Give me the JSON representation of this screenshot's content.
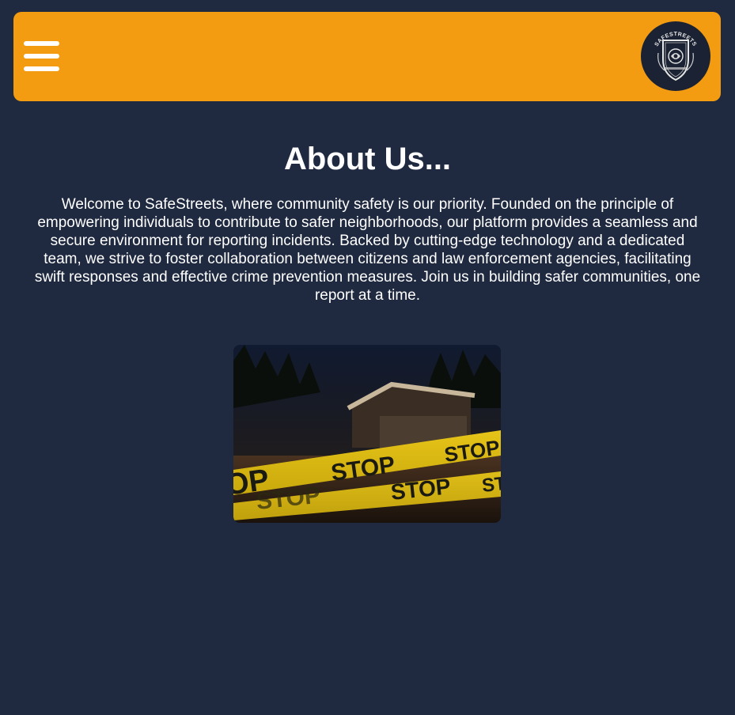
{
  "header": {
    "menu_icon": "hamburger-menu-icon",
    "logo_icon": "safestreets-badge-logo",
    "logo_text": "SAFESTREETS",
    "background_color": "#f39c12"
  },
  "about": {
    "title": "About Us...",
    "body": "Welcome to SafeStreets, where community safety is our priority. Founded on the principle of empowering individuals to contribute to safer neighborhoods, our platform provides a seamless and secure environment for reporting incidents. Backed by cutting-edge technology and a dedicated team, we strive to foster collaboration between citizens and law enforcement agencies, facilitating swift responses and effective crime prevention measures. Join us in building safer communities, one report at a time."
  },
  "hero_image": {
    "tape_words": [
      "STOP",
      "STOP",
      "OP",
      "STOP",
      "STOP",
      "ST"
    ]
  },
  "colors": {
    "page_background": "#1f2940",
    "accent": "#f39c12",
    "text": "#ffffff"
  }
}
